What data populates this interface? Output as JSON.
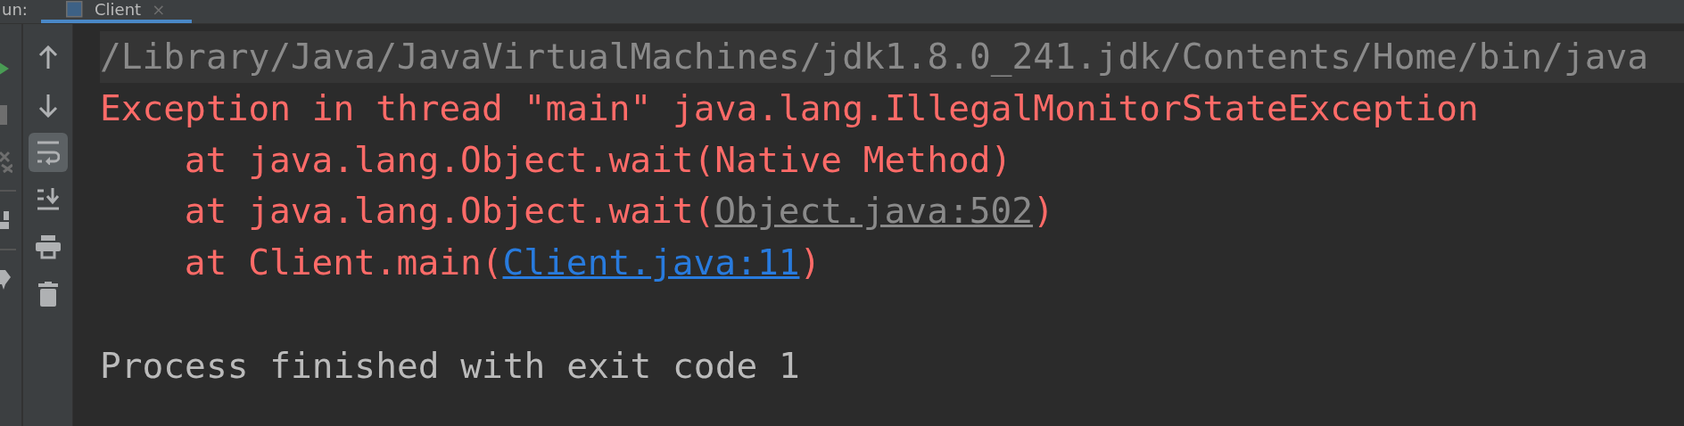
{
  "run_label": "un:",
  "tabs": [
    {
      "label": "Client",
      "selected": true,
      "close": "×"
    }
  ],
  "side_tools": [
    {
      "kind": "run"
    },
    {
      "kind": "stop"
    },
    {
      "kind": "restore"
    },
    {
      "kind": "sep"
    },
    {
      "kind": "layout"
    },
    {
      "kind": "sep"
    },
    {
      "kind": "pin"
    }
  ],
  "console_tools": [
    {
      "kind": "up",
      "on": false
    },
    {
      "kind": "down",
      "on": false
    },
    {
      "kind": "wrap",
      "on": true
    },
    {
      "kind": "scroll-end",
      "on": false
    },
    {
      "kind": "print",
      "on": false
    },
    {
      "kind": "trash",
      "on": false
    }
  ],
  "console_lines": [
    {
      "kind": "command",
      "indented": false,
      "segments": [
        {
          "kind": "text",
          "text": "/Library/Java/JavaVirtualMachines/jdk1.8.0_241.jdk/Contents/Home/bin/java"
        }
      ]
    },
    {
      "kind": "error",
      "indented": false,
      "segments": [
        {
          "kind": "text",
          "text": "Exception in thread \"main\" java.lang.IllegalMonitorStateException"
        }
      ]
    },
    {
      "kind": "error",
      "indented": true,
      "segments": [
        {
          "kind": "text",
          "text": "at java.lang.Object.wait(Native Method)"
        }
      ]
    },
    {
      "kind": "error",
      "indented": true,
      "segments": [
        {
          "kind": "text",
          "text": "at java.lang.Object.wait("
        },
        {
          "kind": "library_link",
          "text": "Object.java:502"
        },
        {
          "kind": "text",
          "text": ")"
        }
      ]
    },
    {
      "kind": "error",
      "indented": true,
      "segments": [
        {
          "kind": "text",
          "text": "at Client.main("
        },
        {
          "kind": "link",
          "text": "Client.java:11"
        },
        {
          "kind": "text",
          "text": ")"
        }
      ]
    },
    {
      "kind": "blank"
    },
    {
      "kind": "normal",
      "indented": false,
      "segments": [
        {
          "kind": "text",
          "text": "Process finished with exit code 1"
        }
      ]
    }
  ]
}
